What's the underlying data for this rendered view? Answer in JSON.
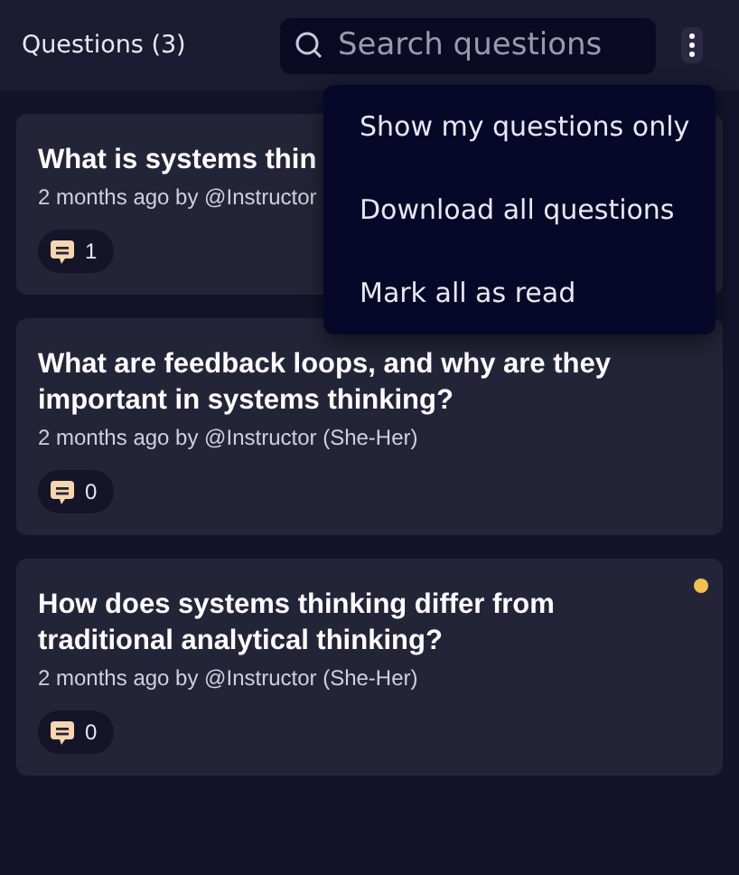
{
  "header": {
    "title": "Questions (3)",
    "search": {
      "placeholder": "Search questions"
    }
  },
  "questions": [
    {
      "title": "What is systems thin",
      "meta": "2 months ago by @Instructor",
      "replies": "1",
      "unread": false
    },
    {
      "title": "What are feedback loops, and why are they important in systems thinking?",
      "meta": "2 months ago by @Instructor (She-Her)",
      "replies": "0",
      "unread": false
    },
    {
      "title": "How does systems thinking differ from traditional analytical thinking?",
      "meta": "2 months ago by @Instructor (She-Her)",
      "replies": "0",
      "unread": true
    }
  ],
  "menu": {
    "open": true,
    "items": [
      "Show my questions only",
      "Download all questions",
      "Mark all as read"
    ]
  }
}
